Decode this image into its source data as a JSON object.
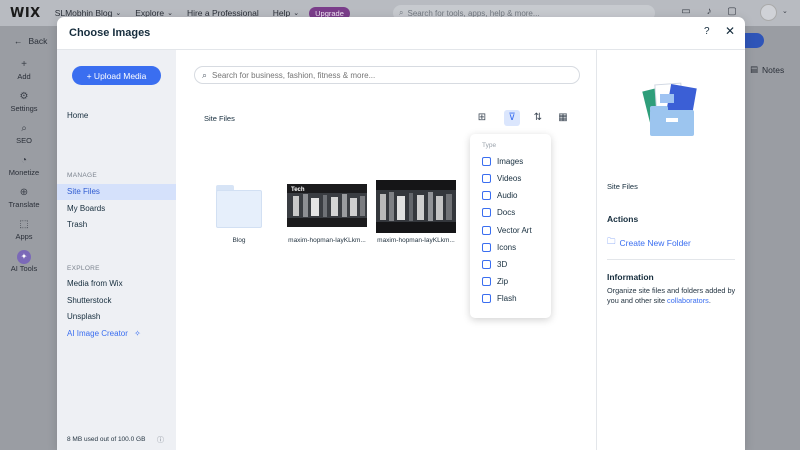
{
  "editor": {
    "logo": "WIX",
    "site_name": "SLMobhin Blog",
    "menu": [
      "Explore",
      "Hire a Professional",
      "Help"
    ],
    "upgrade": "Upgrade",
    "search_placeholder": "Search for tools, apps, help & more...",
    "back": "Back",
    "side_tools": [
      {
        "label": "Add",
        "icon": "plus-icon"
      },
      {
        "label": "Settings",
        "icon": "settings-icon"
      },
      {
        "label": "SEO",
        "icon": "seo-icon"
      },
      {
        "label": "Monetize",
        "icon": "monetize-icon"
      },
      {
        "label": "Translate",
        "icon": "translate-icon"
      },
      {
        "label": "Apps",
        "icon": "apps-icon"
      },
      {
        "label": "AI Tools",
        "icon": "ai-tools-icon"
      }
    ],
    "notes": "Notes"
  },
  "modal": {
    "title": "Choose Images",
    "help": "?",
    "close": "✕"
  },
  "left_pane": {
    "upload_button": "+ Upload Media",
    "home": "Home",
    "manage_heading": "MANAGE",
    "manage_items": [
      "Site Files",
      "My Boards",
      "Trash"
    ],
    "active_item": "Site Files",
    "explore_heading": "EXPLORE",
    "explore_items": [
      "Media from Wix",
      "Shutterstock",
      "Unsplash"
    ],
    "ai_item": "AI Image Creator",
    "storage": "8 MB used out of 100.0 GB"
  },
  "center_pane": {
    "search_placeholder": "Search for business, fashion, fitness & more...",
    "breadcrumb": "Site Files",
    "tiles": [
      {
        "type": "folder",
        "label": "Blog"
      },
      {
        "type": "image",
        "label": "maxim-hopman-IayKLkm...",
        "overlay": "Tech"
      },
      {
        "type": "image",
        "label": "maxim-hopman-IayKLkm..."
      }
    ]
  },
  "filter": {
    "heading": "Type",
    "options": [
      "Images",
      "Videos",
      "Audio",
      "Docs",
      "Vector Art",
      "Icons",
      "3D",
      "Zip",
      "Flash"
    ]
  },
  "right_pane": {
    "title": "Site Files",
    "actions_heading": "Actions",
    "create_folder": "Create New Folder",
    "info_heading": "Information",
    "info_text": "Organize site files and folders added by you and other site ",
    "info_link": "collaborators",
    "info_end": "."
  },
  "colors": {
    "accent": "#3a6ef0",
    "active_bg": "#d5e1fb",
    "upgrade": "#7a3d8a"
  }
}
